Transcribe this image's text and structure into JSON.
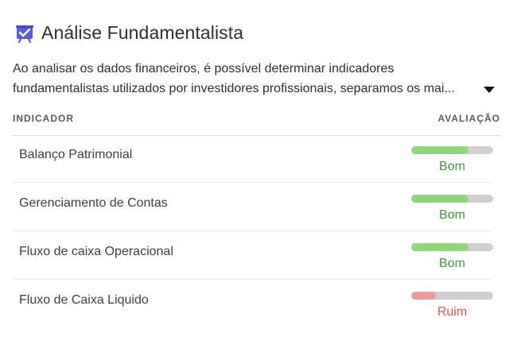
{
  "header": {
    "title": "Análise Fundamentalista",
    "icon": "presentation-chart-check-icon",
    "icon_color": "#5b5bd6"
  },
  "description": {
    "line1": "Ao analisar os dados financeiros, é possível determinar indicadores",
    "line2": "fundamentalistas utilizados por investidores profissionais, separamos os mai..."
  },
  "table": {
    "col_indicator": "INDICADOR",
    "col_rating": "AVALIAÇÃO",
    "rows": [
      {
        "name": "Balanço Patrimonial",
        "rating": "Bom",
        "score": 0.7,
        "color": "#8fd67a",
        "text_color": "#3f9a3b"
      },
      {
        "name": "Gerenciamento de Contas",
        "rating": "Bom",
        "score": 0.7,
        "color": "#8fd67a",
        "text_color": "#3f9a3b"
      },
      {
        "name": "Fluxo de caixa Operacional",
        "rating": "Bom",
        "score": 0.7,
        "color": "#8fd67a",
        "text_color": "#3f9a3b"
      },
      {
        "name": "Fluxo de Caixa Liquido",
        "rating": "Ruim",
        "score": 0.3,
        "color": "#ef9a9a",
        "text_color": "#e05656"
      }
    ]
  }
}
